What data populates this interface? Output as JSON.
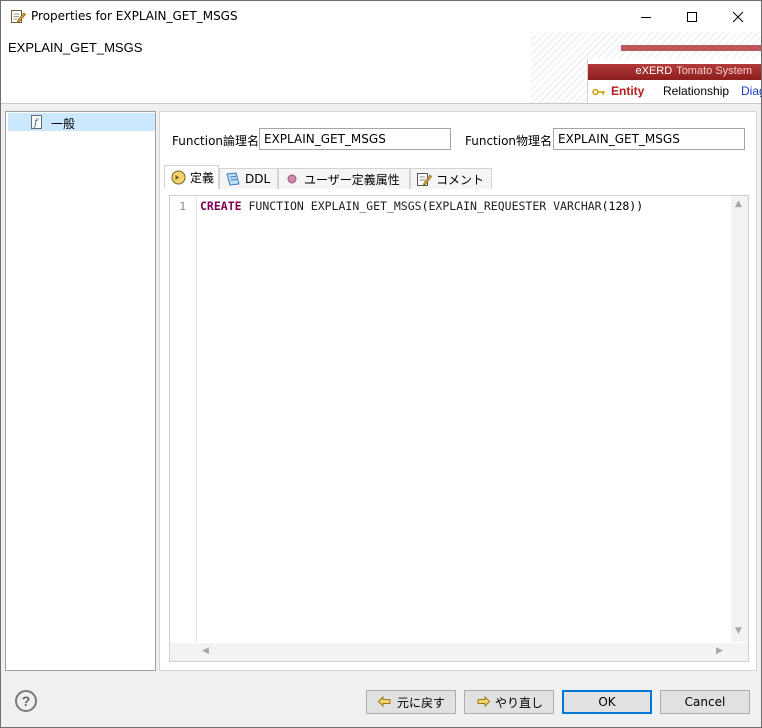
{
  "window": {
    "title": "Properties for EXPLAIN_GET_MSGS",
    "heading": "EXPLAIN_GET_MSGS"
  },
  "banner": {
    "brand": "eXERD",
    "subtitle": "Tomato System",
    "tabs": [
      "Entity",
      "Relationship",
      "Diag"
    ]
  },
  "tree": {
    "items": [
      {
        "label": "一般",
        "icon": "function-icon"
      }
    ]
  },
  "form": {
    "logical_label": "Function論理名",
    "logical_value": "EXPLAIN_GET_MSGS",
    "physical_label": "Function物理名",
    "physical_value": "EXPLAIN_GET_MSGS"
  },
  "tabs": [
    {
      "label": "定義",
      "icon": "definition-icon",
      "active": true
    },
    {
      "label": "DDL",
      "icon": "ddl-icon",
      "active": false
    },
    {
      "label": "ユーザー定義属性",
      "icon": "dot-icon",
      "active": false
    },
    {
      "label": "コメント",
      "icon": "comment-icon",
      "active": false
    }
  ],
  "editor": {
    "line_number": "1",
    "keyword": "CREATE",
    "code_a": " FUNCTION EXPLAIN_GET_MSGS",
    "paren_open": "(",
    "code_b": "EXPLAIN_REQUESTER VARCHAR",
    "code_c": "(128))"
  },
  "footer": {
    "help": "?",
    "undo_label": "元に戻す",
    "redo_label": "やり直し",
    "ok_label": "OK",
    "cancel_label": "Cancel"
  },
  "colors": {
    "accent": "#0078d7",
    "banner": "#8c1e1e",
    "keyword": "#7f0055",
    "selection": "#cce8ff"
  }
}
